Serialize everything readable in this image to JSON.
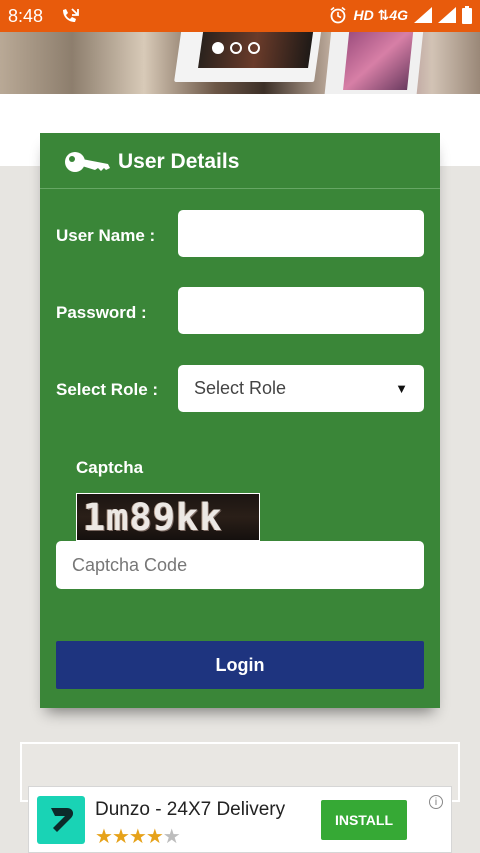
{
  "status_bar": {
    "time": "8:48",
    "network": "HD",
    "network_type": "4G",
    "icons": [
      "missed-call-icon",
      "alarm-icon",
      "signal-icon",
      "signal-icon",
      "battery-icon"
    ]
  },
  "banner": {
    "slides": 3,
    "active_slide": 1
  },
  "form": {
    "title": "User Details",
    "icon": "key-icon",
    "username_label": "User Name :",
    "password_label": "Password :",
    "role_label": "Select Role :",
    "role_selected": "Select Role",
    "captcha_label": "Captcha",
    "captcha_text": "1m89kk",
    "captcha_placeholder": "Captcha Code",
    "login_label": "Login"
  },
  "ad": {
    "app_name": "Dunzo - 24X7 Delivery",
    "rating_stars": 4,
    "install_label": "INSTALL",
    "info_glyph": "i"
  },
  "colors": {
    "status_bar": "#e85b0c",
    "panel": "#3a8638",
    "login_button": "#1e347f",
    "install_button": "#36a935",
    "dunzo_logo": "#19d3b5"
  }
}
